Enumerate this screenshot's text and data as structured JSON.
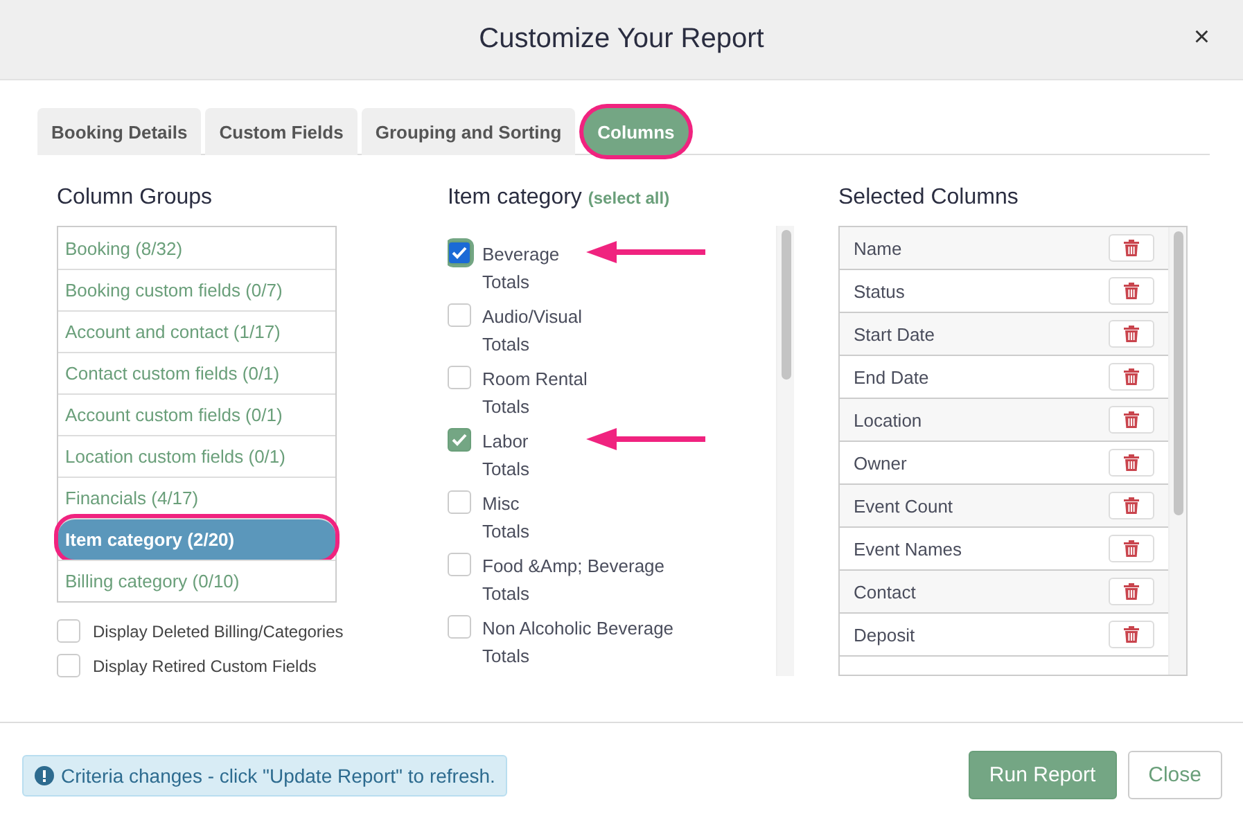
{
  "dialog": {
    "title": "Customize Your Report",
    "close": "×"
  },
  "tabs": [
    {
      "label": "Booking Details",
      "selected": false,
      "highlighted": false
    },
    {
      "label": "Custom Fields",
      "selected": false,
      "highlighted": false
    },
    {
      "label": "Grouping and Sorting",
      "selected": false,
      "highlighted": false
    },
    {
      "label": "Columns",
      "selected": true,
      "highlighted": true
    }
  ],
  "column_groups": {
    "title": "Column Groups",
    "items": [
      {
        "label": "Booking (8/32)",
        "selected": false,
        "highlighted": false
      },
      {
        "label": "Booking custom fields (0/7)",
        "selected": false,
        "highlighted": false
      },
      {
        "label": "Account and contact (1/17)",
        "selected": false,
        "highlighted": false
      },
      {
        "label": "Contact custom fields (0/1)",
        "selected": false,
        "highlighted": false
      },
      {
        "label": "Account custom fields (0/1)",
        "selected": false,
        "highlighted": false
      },
      {
        "label": "Location custom fields (0/1)",
        "selected": false,
        "highlighted": false
      },
      {
        "label": "Financials (4/17)",
        "selected": false,
        "highlighted": false
      },
      {
        "label": "Item category (2/20)",
        "selected": true,
        "highlighted": true
      },
      {
        "label": "Billing category (0/10)",
        "selected": false,
        "highlighted": false
      }
    ],
    "options": [
      {
        "label": "Display Deleted Billing/Categories",
        "checked": false
      },
      {
        "label": "Display Retired Custom Fields",
        "checked": false
      }
    ]
  },
  "item_category": {
    "title": "Item category",
    "select_all": "(select all)",
    "items": [
      {
        "label": "Beverage",
        "sub": "Totals",
        "checked": true,
        "focused": true,
        "annotated": true
      },
      {
        "label": "Audio/Visual",
        "sub": "Totals",
        "checked": false,
        "focused": false,
        "annotated": false
      },
      {
        "label": "Room Rental",
        "sub": "Totals",
        "checked": false,
        "focused": false,
        "annotated": false
      },
      {
        "label": "Labor",
        "sub": "Totals",
        "checked": true,
        "focused": false,
        "annotated": true
      },
      {
        "label": "Misc",
        "sub": "Totals",
        "checked": false,
        "focused": false,
        "annotated": false
      },
      {
        "label": "Food &Amp; Beverage",
        "sub": "Totals",
        "checked": false,
        "focused": false,
        "annotated": false
      },
      {
        "label": "Non Alcoholic Beverage",
        "sub": "Totals",
        "checked": false,
        "focused": false,
        "annotated": false
      }
    ]
  },
  "selected_columns": {
    "title": "Selected Columns",
    "items": [
      "Name",
      "Status",
      "Start Date",
      "End Date",
      "Location",
      "Owner",
      "Event Count",
      "Event Names",
      "Contact",
      "Deposit"
    ]
  },
  "footer": {
    "notice": "Criteria changes - click \"Update Report\" to refresh.",
    "buttons": [
      {
        "label": "Run Report",
        "kind": "primary"
      },
      {
        "label": "Close",
        "kind": "secondary"
      }
    ]
  }
}
